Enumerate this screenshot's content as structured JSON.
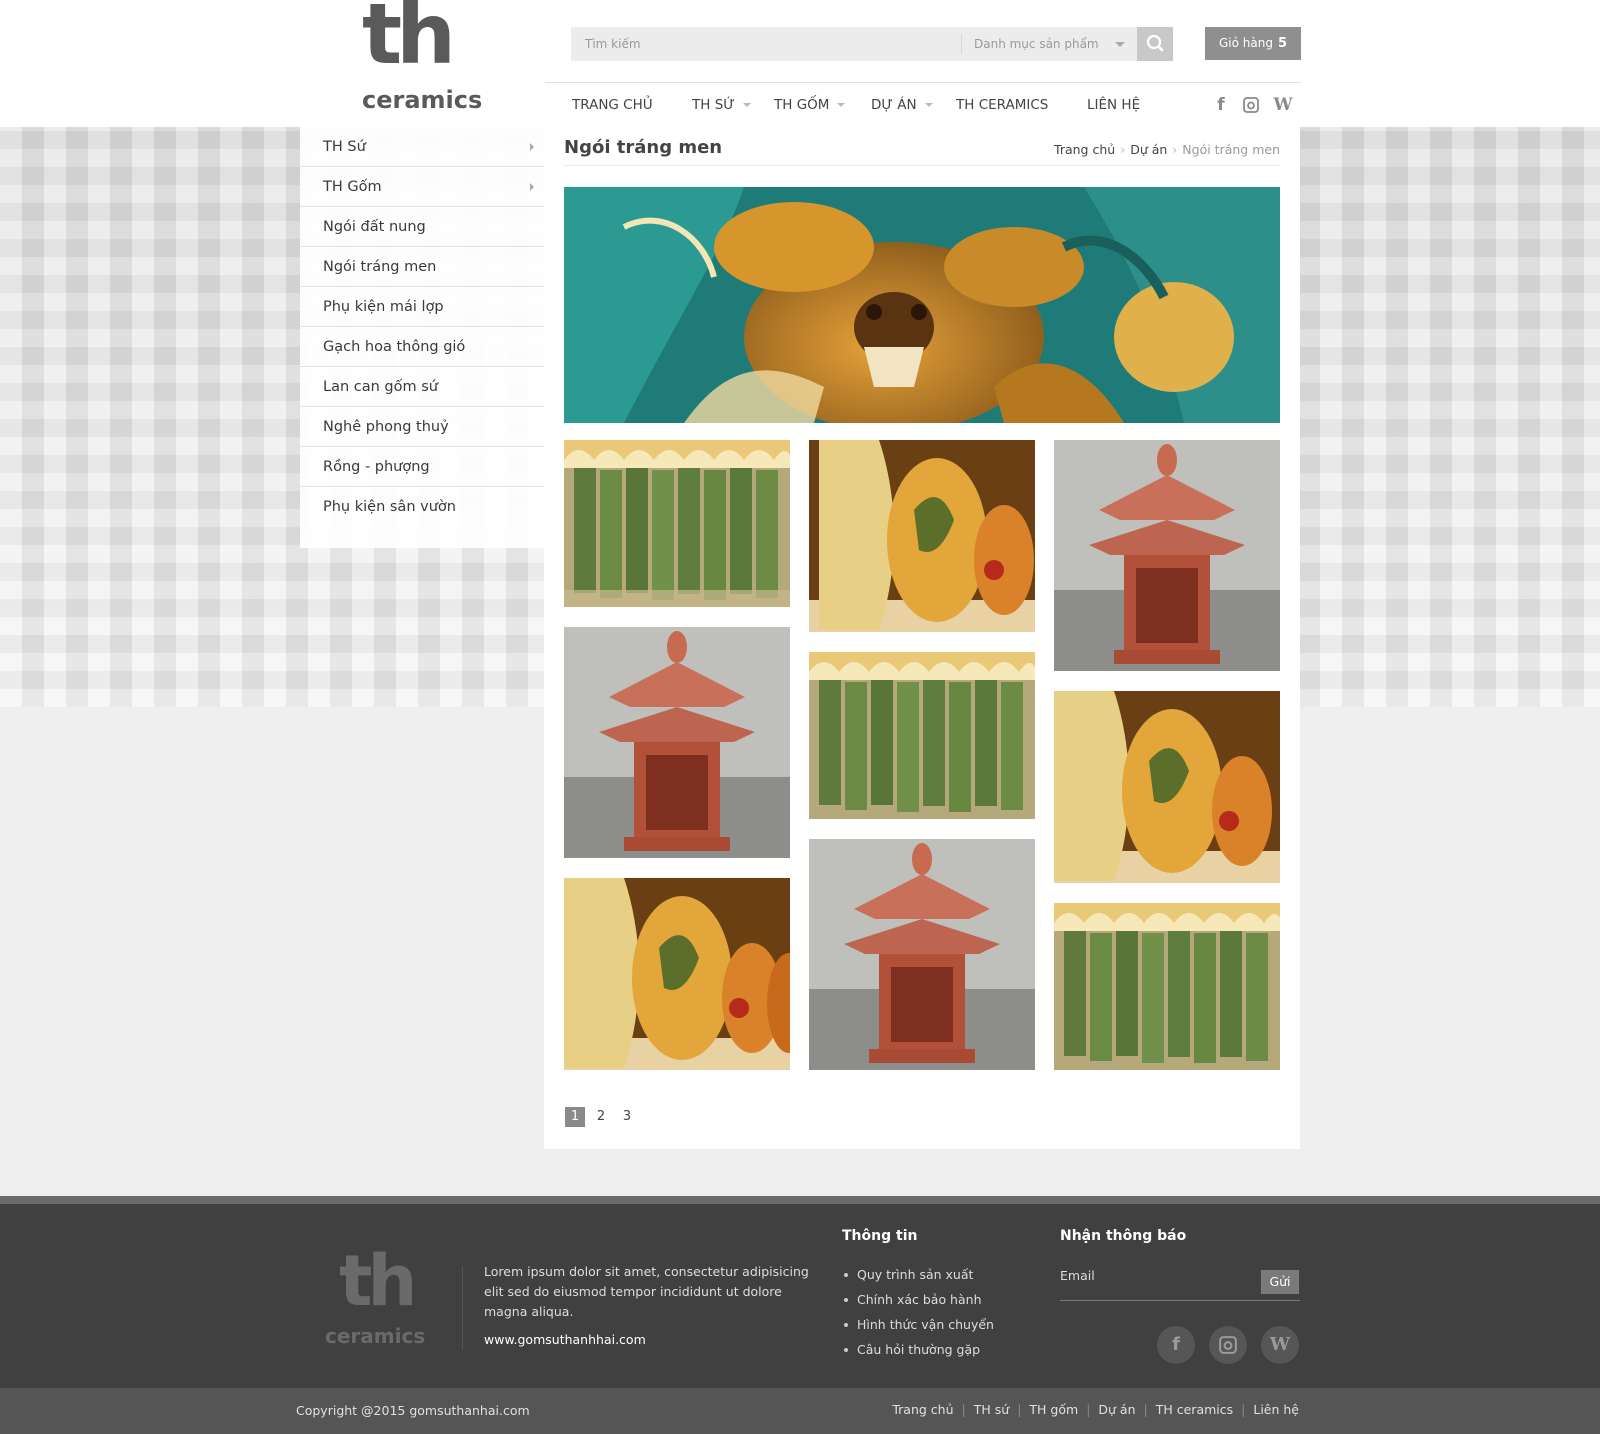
{
  "brand": {
    "logo_top": "th",
    "logo_bottom": "ceramics"
  },
  "search": {
    "placeholder": "Tìm kiếm",
    "category_label": "Danh mục sản phẩm"
  },
  "cart": {
    "label": "Giỏ hàng",
    "count": "5"
  },
  "nav": [
    "TRANG CHỦ",
    "TH SỨ",
    "TH GỐM",
    "DỰ ÁN",
    "TH CERAMICS",
    "LIÊN HỆ"
  ],
  "social": {
    "facebook": "f",
    "instagram": "◘",
    "wordpress": "W"
  },
  "sidebar": {
    "items": [
      {
        "label": "TH Sứ"
      },
      {
        "label": "TH Gốm"
      },
      {
        "label": "Ngói đất nung"
      },
      {
        "label": "Ngói tráng men"
      },
      {
        "label": "Phụ kiện mái lợp"
      },
      {
        "label": "Gạch hoa thông gió"
      },
      {
        "label": "Lan can gốm sứ"
      },
      {
        "label": "Nghê phong thuỷ"
      },
      {
        "label": "Rồng - phượng"
      },
      {
        "label": "Phụ kiện sân vườn"
      }
    ]
  },
  "main": {
    "title": "Ngói tráng men",
    "breadcrumb": [
      "Trang chủ",
      "Dự án",
      "Ngói tráng men"
    ]
  },
  "pagination": [
    "1",
    "2",
    "3"
  ],
  "footer": {
    "about": "Lorem ipsum dolor sit amet, consectetur adipisicing elit sed do eiusmod tempor incididunt ut dolore magna aliqua.",
    "site": "www.gomsuthanhhai.com",
    "info_title": "Thông tin",
    "info_links": [
      "Quy trình sản xuất",
      "Chính xác bảo hành",
      "Hình thức vận chuyển",
      "Câu hỏi thường gặp"
    ],
    "newsletter_title": "Nhận thông báo",
    "email_label": "Email",
    "send_label": "Gửi",
    "copyright": "Copyright @2015 gomsuthanhai.com",
    "bottom_links": [
      "Trang chủ",
      "TH sứ",
      "TH gốm",
      "Dự án",
      "TH ceramics",
      "Liên hệ"
    ]
  },
  "colors": {
    "brand_gray": "#5a5a5a",
    "footer_bg": "#404040",
    "accent_button": "#8f8f8f"
  }
}
